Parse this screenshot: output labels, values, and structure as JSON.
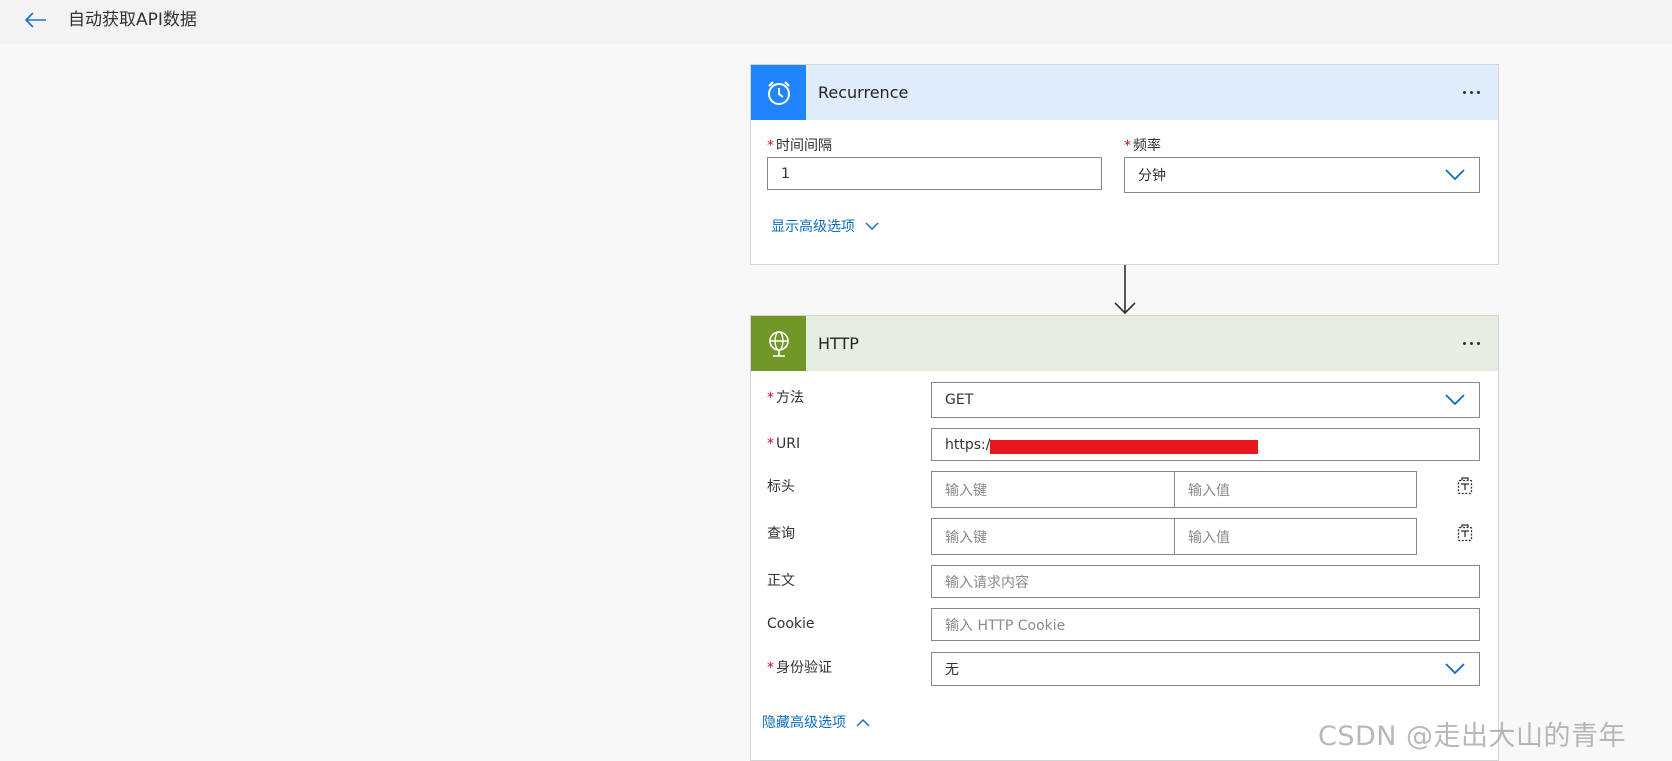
{
  "header": {
    "title": "自动获取API数据"
  },
  "recurrence": {
    "title": "Recurrence",
    "interval_label": "时间间隔",
    "interval_value": "1",
    "frequency_label": "频率",
    "frequency_value": "分钟",
    "advanced_link": "显示高级选项",
    "header_color": "#deecfc",
    "icon_color": "#1f85ff"
  },
  "http": {
    "title": "HTTP",
    "header_color": "#e6efdf",
    "icon_color": "#709727",
    "method_label": "方法",
    "method_value": "GET",
    "uri_label": "URI",
    "uri_value": "https:/",
    "headers_label": "标头",
    "headers_key_placeholder": "输入键",
    "headers_value_placeholder": "输入值",
    "query_label": "查询",
    "query_key_placeholder": "输入键",
    "query_value_placeholder": "输入值",
    "body_label": "正文",
    "body_placeholder": "输入请求内容",
    "cookie_label": "Cookie",
    "cookie_placeholder": "输入 HTTP Cookie",
    "auth_label": "身份验证",
    "auth_value": "无",
    "advanced_link": "隐藏高级选项"
  },
  "required_mark": "*",
  "watermark": "CSDN @走出大山的青年",
  "accent_color": "#0f6cbd"
}
